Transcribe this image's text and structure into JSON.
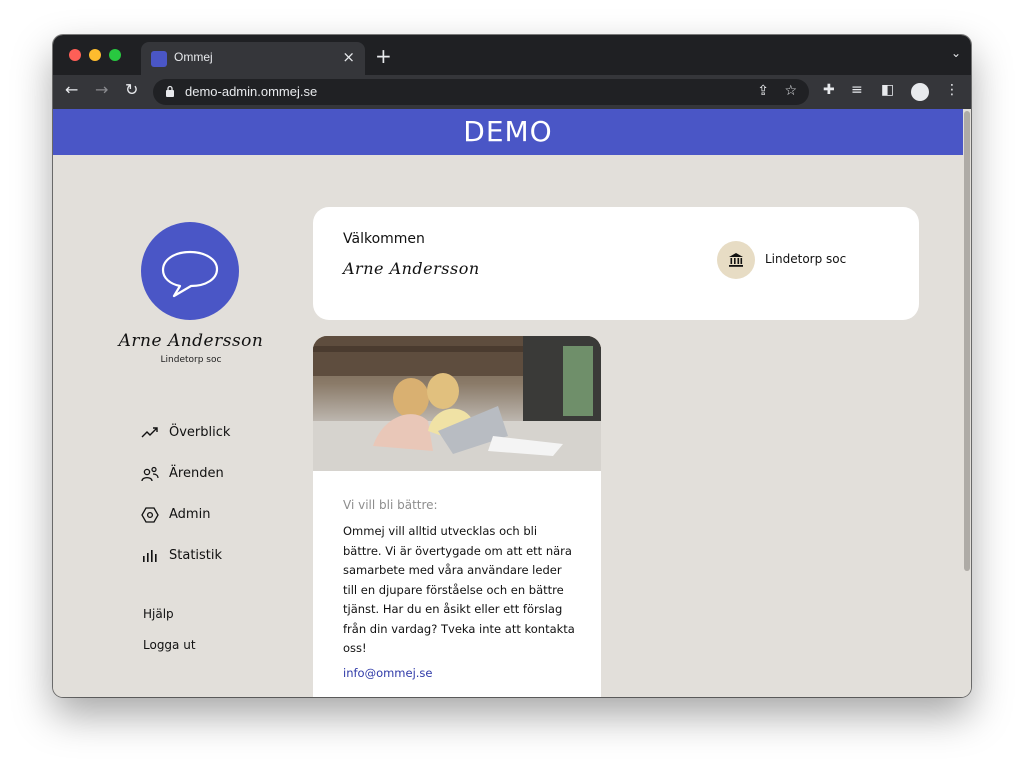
{
  "browser": {
    "tab_title": "Ommej",
    "url": "demo-admin.ommej.se"
  },
  "banner": {
    "text": "DEMO"
  },
  "sidebar": {
    "user_signature": "Arne Andersson",
    "org": "Lindetorp soc",
    "nav": [
      {
        "label": "Överblick",
        "icon": "trend-up-icon"
      },
      {
        "label": "Ärenden",
        "icon": "people-icon"
      },
      {
        "label": "Admin",
        "icon": "hexagon-settings-icon"
      },
      {
        "label": "Statistik",
        "icon": "bar-chart-icon"
      }
    ],
    "links": [
      {
        "label": "Hjälp"
      },
      {
        "label": "Logga ut"
      }
    ]
  },
  "welcome": {
    "title": "Välkommen",
    "signature": "Arne Andersson",
    "org_name": "Lindetorp soc"
  },
  "info": {
    "heading": "Vi vill bli bättre:",
    "body": "Ommej vill alltid utvecklas och bli bättre. Vi är övertygade om att ett nära samarbete med våra användare leder till en djupare förståelse och en bättre tjänst. Har du en åsikt eller ett förslag från din vardag? Tveka inte att kontakta oss!",
    "email": "info@ommej.se"
  },
  "colors": {
    "brand": "#4a56c6",
    "page_bg": "#e2dfda",
    "badge": "#e7dcc4"
  }
}
